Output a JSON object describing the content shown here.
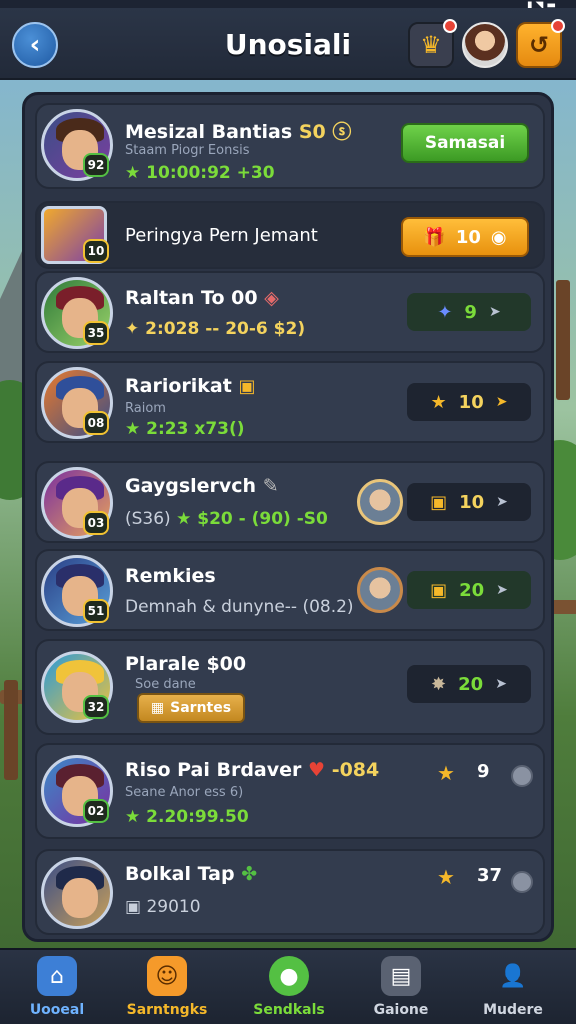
{
  "header": {
    "title": "Unosiali",
    "back_icon": "back-arrow-icon",
    "crown_icon": "crown-icon",
    "quest_icon": "quest-icon"
  },
  "rows": [
    {
      "name": "Mesizal Bantias",
      "name_tag": "S0 ⓢ",
      "sub": "Staam Piogr Eonsis",
      "stat": "★ 10:00:92  +30",
      "level": "92",
      "action_label": "Samasai"
    },
    {
      "text": "Peringya Pern Jemant",
      "level": "10",
      "action_label": "10"
    },
    {
      "name": "Raltan To 00",
      "stat": "✦ 2:028 -- 20-6 $2)",
      "level": "35",
      "reward_value": "9"
    },
    {
      "name": "Rariorikat",
      "sub": "Raiom",
      "stat": "★ 2:23  x73()",
      "level": "08",
      "reward_value": "10"
    },
    {
      "name": "Gaygslervch",
      "stat_prefix": "(S36)",
      "stat": "★ $20 - (90) -S0",
      "level": "03",
      "reward_value": "10"
    },
    {
      "name": "Remkies",
      "stat": "Demnah & dunyne-- (08.2)",
      "level": "51",
      "reward_value": "20"
    },
    {
      "name": "Plarale $00",
      "sub": "Soe dane",
      "chip_label": "Sarntes",
      "level": "32",
      "reward_value": "20"
    },
    {
      "name": "Riso Pai Brdaver",
      "name_tag": "-084",
      "sub": "Seane Anor ess 6)",
      "stat": "★ 2.20:99.50",
      "level": "02",
      "side_value": "9"
    },
    {
      "name": "Bolkal Tap",
      "stat": "▣ 29010",
      "level": "",
      "side_value": "37"
    }
  ],
  "nav": [
    {
      "label": "Uooeal",
      "icon": "home-icon"
    },
    {
      "label": "Sarntngks",
      "icon": "chat-icon"
    },
    {
      "label": "Sendkals",
      "icon": "globe-icon"
    },
    {
      "label": "Gaione",
      "icon": "cards-icon"
    },
    {
      "label": "Mudere",
      "icon": "profile-icon"
    }
  ]
}
